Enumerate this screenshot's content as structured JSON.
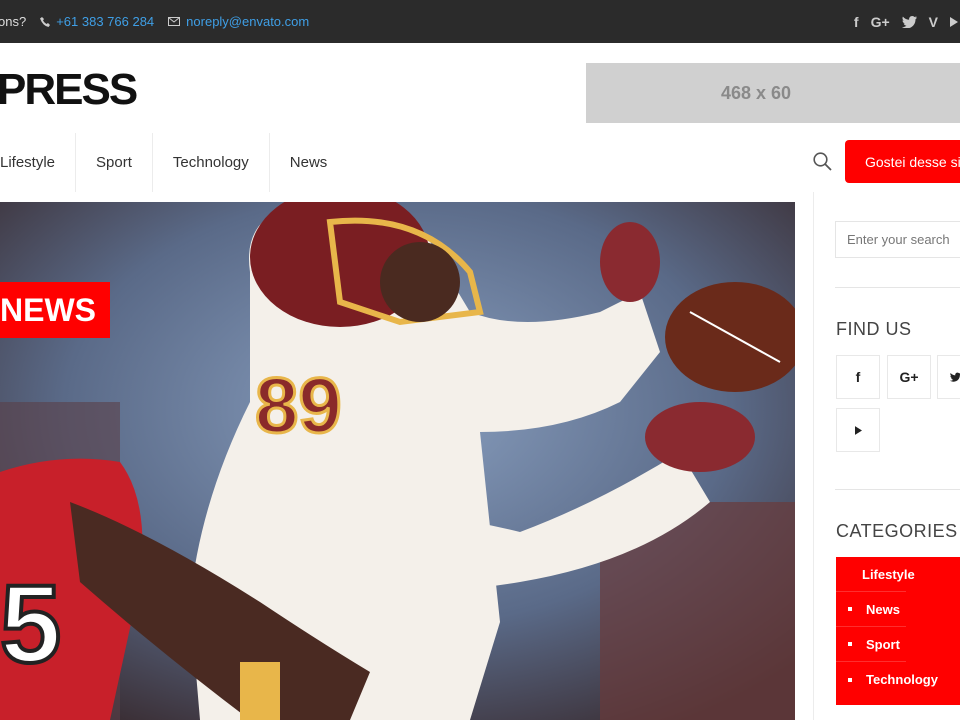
{
  "topbar": {
    "question": "ons?",
    "phone": "+61 383 766 284",
    "email": "noreply@envato.com",
    "social_icons": [
      "facebook-icon",
      "google-plus-icon",
      "twitter-icon",
      "vimeo-icon",
      "youtube-icon"
    ]
  },
  "header": {
    "logo": "PRESS",
    "ad_label": "468 x 60"
  },
  "nav": {
    "items": [
      "Lifestyle",
      "Sport",
      "Technology",
      "News"
    ],
    "button_label": "Gostei desse site"
  },
  "hero": {
    "badge": "NEWS"
  },
  "sidebar": {
    "search_placeholder": "Enter your search",
    "find_us_title": "FIND US",
    "find_us_icons": [
      "facebook-icon",
      "google-plus-icon",
      "twitter-icon",
      "youtube-icon"
    ],
    "categories_title": "CATEGORIES",
    "categories": [
      "Lifestyle",
      "News",
      "Sport",
      "Technology"
    ]
  },
  "colors": {
    "accent": "#ff0000",
    "topbar_bg": "#2b2b2b",
    "link": "#3f9fe6"
  }
}
